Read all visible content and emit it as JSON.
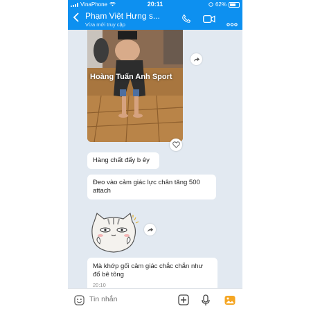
{
  "status": {
    "carrier": "VinaPhone",
    "time": "20:11",
    "battery": "62%"
  },
  "header": {
    "title": "Phạm Việt Hưng s...",
    "subtitle": "Vừa mới truy cập"
  },
  "photo": {
    "watermark": "Hoàng Tuấn Anh Sport"
  },
  "messages": [
    {
      "text": "Hàng chất đấy b êy"
    },
    {
      "text": "Đeo vào cảm giác lực chân tăng 500 attach"
    },
    {
      "text": "Mà khớp gối cảm giác chắc chắn như đổ bê tông",
      "time": "20:10"
    }
  ],
  "input": {
    "placeholder": "Tin nhắn"
  },
  "colors": {
    "header": "#0d90f0",
    "chat_bg": "#e2e9f1",
    "bubble": "#ffffff",
    "input_icon": "#f5a623"
  },
  "icons": {
    "back": "back-arrow-icon",
    "call": "phone-icon",
    "video": "video-icon",
    "more": "more-icon",
    "heart": "heart-icon",
    "share": "share-icon",
    "sticker": "sticker-icon",
    "add": "plus-icon",
    "mic": "microphone-icon",
    "image": "image-icon"
  }
}
